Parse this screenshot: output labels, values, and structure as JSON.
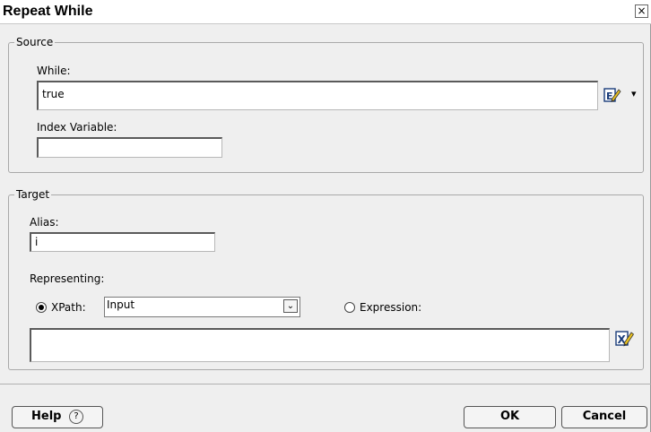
{
  "window": {
    "title": "Repeat While",
    "close_glyph": "×"
  },
  "source": {
    "legend": "Source",
    "while_label": "While:",
    "while_value": "true",
    "index_label": "Index Variable:",
    "index_value": "",
    "editor_icon": "expression-editor-icon",
    "menu_arrow": "▾"
  },
  "target": {
    "legend": "Target",
    "alias_label": "Alias:",
    "alias_value": "i",
    "representing_label": "Representing:",
    "xpath_label": "XPath:",
    "xpath_selected": true,
    "xpath_value": "Input",
    "expression_label": "Expression:",
    "expression_selected": false,
    "expression_value": "",
    "xpath_editor_icon": "xpath-editor-icon",
    "dropdown_glyph": "⌄"
  },
  "footer": {
    "help_label": "Help",
    "help_glyph": "?",
    "ok_label": "OK",
    "cancel_label": "Cancel"
  }
}
